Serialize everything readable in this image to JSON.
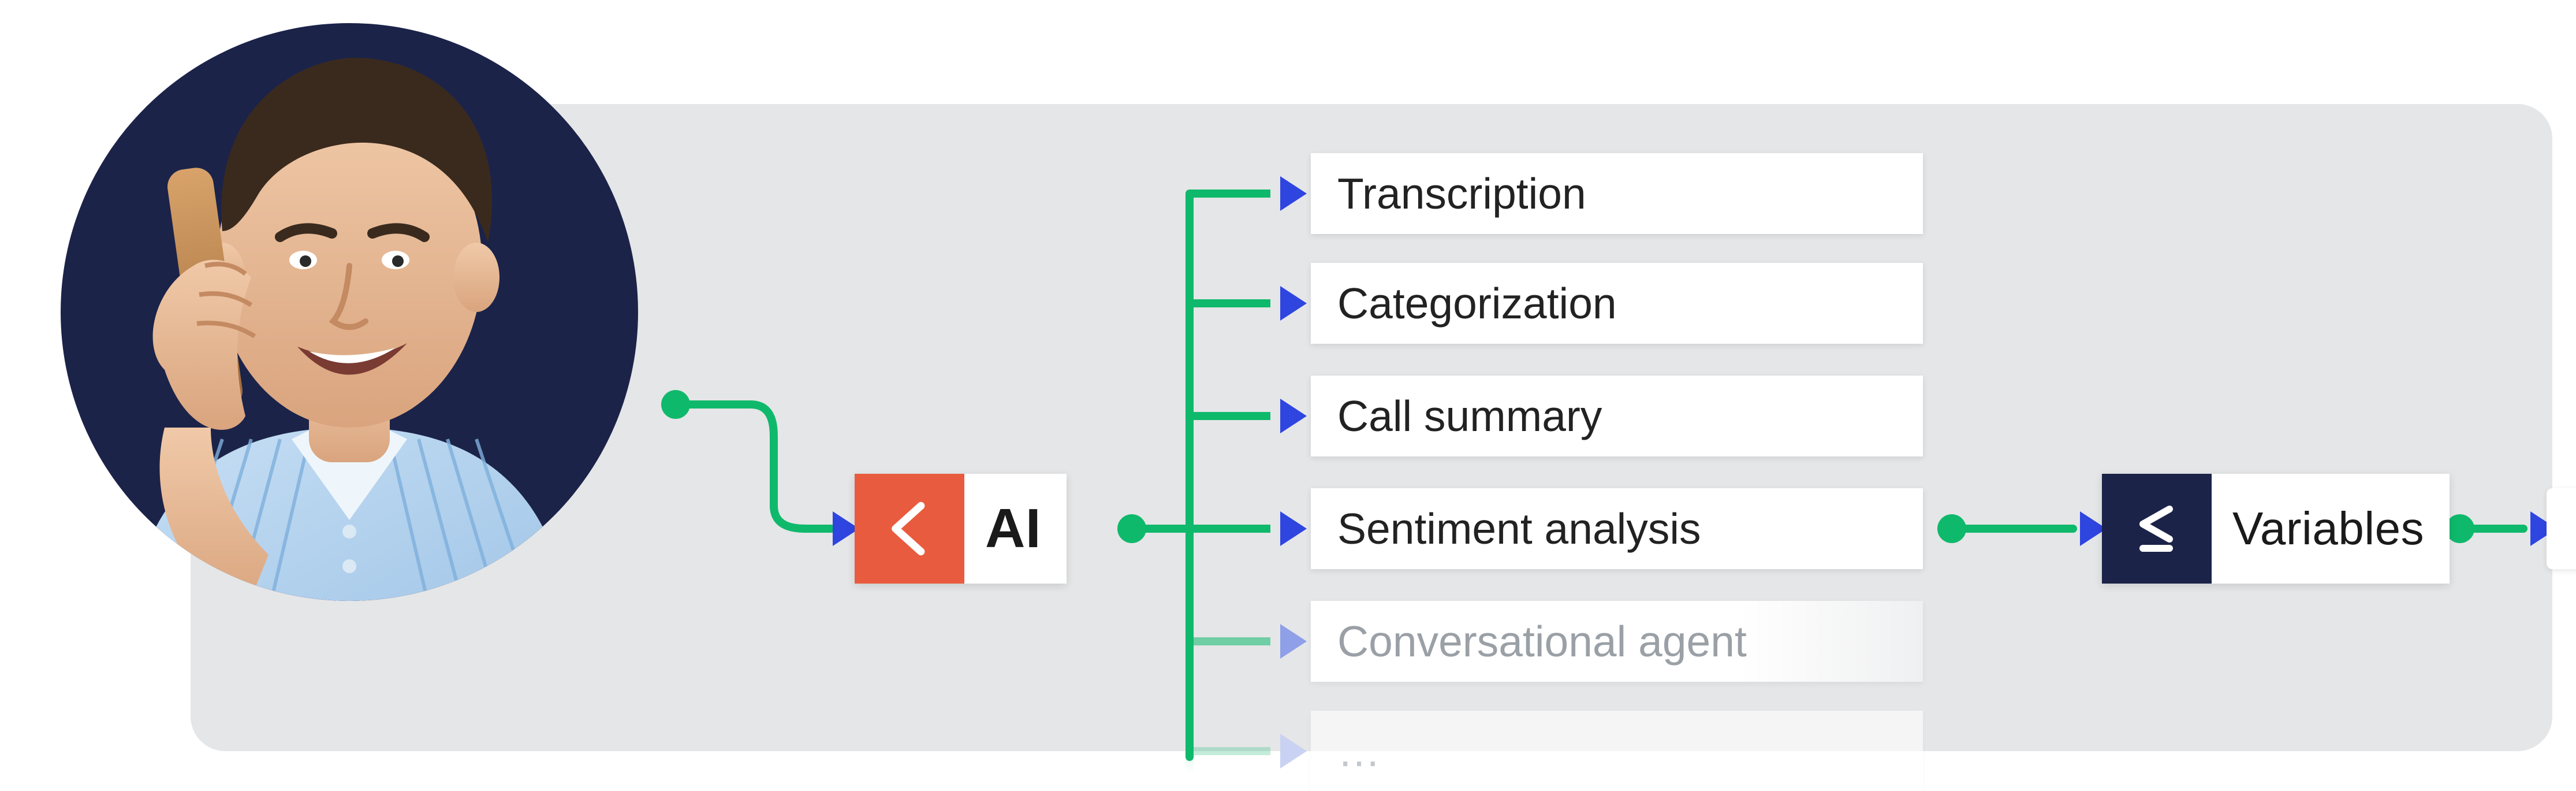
{
  "colors": {
    "background_panel": "#e5e6e8",
    "avatar_bg": "#1b2349",
    "connector": "#0fb96b",
    "connector_arrow": "#2f45e0",
    "ai_icon_bg": "#e95b3e",
    "var_icon_bg": "#1b2349"
  },
  "avatar": {
    "description": "Person smiling while holding a phone to their ear",
    "shirt_color": "light blue striped"
  },
  "nodes": {
    "ai": {
      "label": "AI",
      "icon_name": "angle-bracket-left"
    },
    "variables": {
      "label": "Variables",
      "icon_name": "less-equal"
    }
  },
  "capabilities": [
    {
      "label": "Transcription",
      "state": "normal"
    },
    {
      "label": "Categorization",
      "state": "normal"
    },
    {
      "label": "Call summary",
      "state": "normal"
    },
    {
      "label": "Sentiment analysis",
      "state": "normal"
    },
    {
      "label": "Conversational agent",
      "state": "faded"
    },
    {
      "label": "…",
      "state": "ghost"
    }
  ],
  "flow": {
    "description": "Caller → AI → one of the listed AI capabilities → Variables → (next step)"
  }
}
